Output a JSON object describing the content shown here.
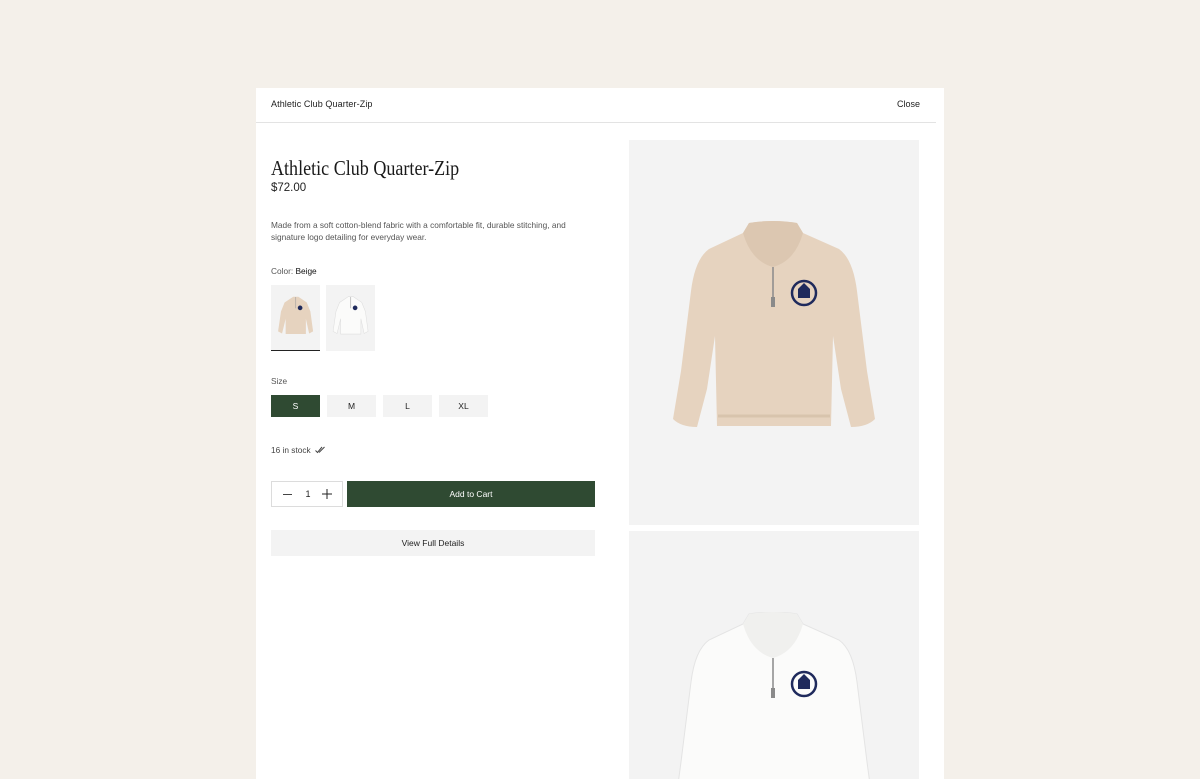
{
  "header": {
    "title": "Athletic Club Quarter-Zip",
    "close_label": "Close"
  },
  "product": {
    "title": "Athletic Club Quarter-Zip",
    "price": "$72.00",
    "description": "Made from a soft cotton-blend fabric with a comfortable fit, durable stitching, and signature logo detailing for everyday wear."
  },
  "color": {
    "label": "Color:",
    "selected": "Beige",
    "swatches": [
      {
        "name": "Beige",
        "hex": "#e6d3bf"
      },
      {
        "name": "White",
        "hex": "#f7f7f5"
      }
    ]
  },
  "size": {
    "label": "Size",
    "options": [
      "S",
      "M",
      "L",
      "XL"
    ],
    "selected": "S"
  },
  "stock": {
    "text": "16 in stock",
    "icon": "double-check-icon"
  },
  "quantity": {
    "value": "1",
    "minus_icon": "minus-icon",
    "plus_icon": "plus-icon"
  },
  "actions": {
    "add_to_cart": "Add to Cart",
    "view_details": "View Full Details"
  },
  "colors": {
    "accent": "#2f4a32",
    "page_bg": "#f4f0ea",
    "panel_bg": "#f3f3f3",
    "logo_navy": "#1f2a5c"
  }
}
